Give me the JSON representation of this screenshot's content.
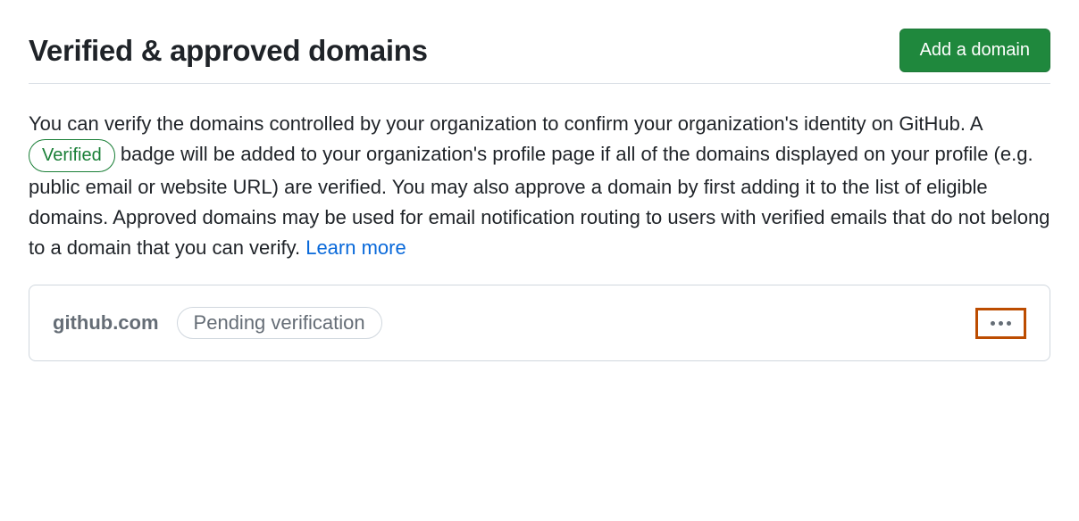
{
  "header": {
    "title": "Verified & approved domains",
    "add_button_label": "Add a domain"
  },
  "description": {
    "text_before_badge": "You can verify the domains controlled by your organization to confirm your organization's identity on GitHub. A ",
    "badge_label": "Verified",
    "text_after_badge": " badge will be added to your organization's profile page if all of the domains displayed on your profile (e.g. public email or website URL) are verified. You may also approve a domain by first adding it to the list of eligible domains. Approved domains may be used for email notification routing to users with verified emails that do not belong to a domain that you can verify. ",
    "learn_more_label": "Learn more"
  },
  "domains": [
    {
      "name": "github.com",
      "status_label": "Pending verification"
    }
  ]
}
